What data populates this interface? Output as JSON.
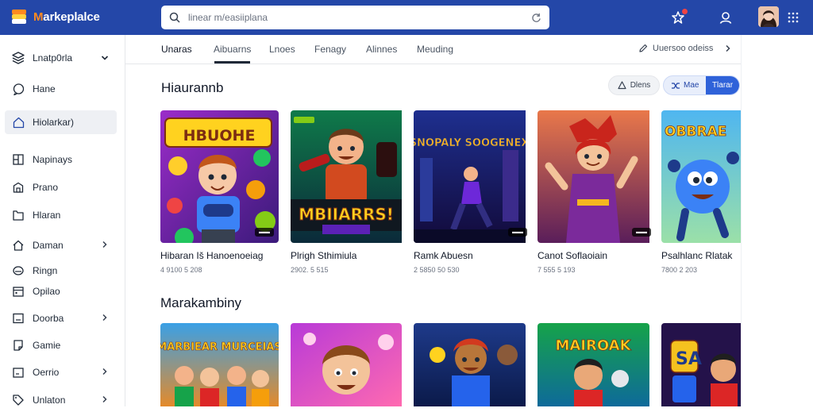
{
  "header": {
    "logo_text_first": "M",
    "logo_text_rest": "arkeplalce",
    "search_placeholder": "linear m/easiiplana",
    "colors": {
      "bar": "#2447a8",
      "logo_accent": "#ff8a1f"
    },
    "icons": [
      "layers-logo-icon",
      "search-icon",
      "refresh-icon",
      "notification-icon",
      "user-icon",
      "avatar",
      "apps-grid-icon"
    ]
  },
  "sidebar": {
    "items": [
      {
        "label": "Lnatp0rla",
        "icon": "stack-icon",
        "chevron": "down"
      },
      {
        "label": "Hane",
        "icon": "chat-icon"
      },
      {
        "label": "Hiolarkar)",
        "icon": "home-icon",
        "active": true
      },
      {
        "label": "Napinays",
        "icon": "grid-icon"
      },
      {
        "label": "Prano",
        "icon": "building-icon"
      },
      {
        "label": "Hlaran",
        "icon": "folder-icon"
      },
      {
        "label": "Daman",
        "icon": "house-icon",
        "chevron": "right"
      },
      {
        "label": "Ringn",
        "icon": "disc-icon"
      },
      {
        "label": "Opilao",
        "icon": "calendar-icon"
      },
      {
        "label": "Doorba",
        "icon": "window-icon",
        "chevron": "right"
      },
      {
        "label": "Gamie",
        "icon": "note-icon"
      },
      {
        "label": "Oerrio",
        "icon": "box-icon",
        "chevron": "right"
      },
      {
        "label": "Unlaton",
        "icon": "tag-icon",
        "chevron": "right"
      }
    ]
  },
  "tabs": {
    "items": [
      "Unaras",
      "Aibuarns",
      "Lnoes",
      "Fenagy",
      "Alinnes",
      "Meuding"
    ],
    "active_index": 0,
    "right_label": "Uuersoo odeiss"
  },
  "section1": {
    "title": "Hiaurannb",
    "btn_a": "Dlens",
    "btn_b_left": "Mae",
    "btn_b_right": "Tlarar"
  },
  "cards_row1": [
    {
      "title": "Hibaran Iš Hanoenoeiag",
      "meta": "4 9100 5 208",
      "art_text": "HBUOHE",
      "badge": "▬▬"
    },
    {
      "title": "Plrigh Sthimiula",
      "meta": "2902. 5 515",
      "art_text": "MBIIARRS!",
      "badge": ""
    },
    {
      "title": "Ramk Abuesn",
      "meta": "2 5850 50 530",
      "art_text": "SNOPALY SOOGENEX",
      "badge": "▬▬"
    },
    {
      "title": "Canot Soflaoiain",
      "meta": "7 555 5 193",
      "art_text": "",
      "badge": "▬▬"
    },
    {
      "title": "Psalhlanc Rlatak",
      "meta": "7800 2 203",
      "art_text": "OBBRAE",
      "badge": ""
    }
  ],
  "section2": {
    "title": "Marakambiny"
  },
  "cards_row2": [
    {
      "art_text": "MARBIEAR MURCEIAS"
    },
    {
      "art_text": ""
    },
    {
      "art_text": ""
    },
    {
      "art_text": "MAIROAK"
    },
    {
      "art_text": "SA"
    }
  ]
}
